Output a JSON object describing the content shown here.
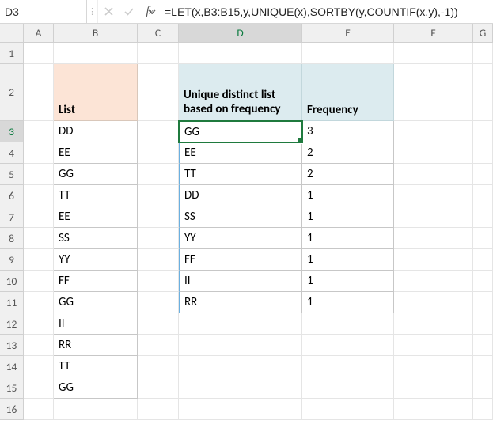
{
  "namebox": "D3",
  "formula": "=LET(x,B3:B15,y,UNIQUE(x),SORTBY(y,COUNTIF(x,y),-1))",
  "columns": [
    "A",
    "B",
    "C",
    "D",
    "E",
    "F",
    "G"
  ],
  "rows": [
    "1",
    "2",
    "3",
    "4",
    "5",
    "6",
    "7",
    "8",
    "9",
    "10",
    "11",
    "12",
    "13",
    "14",
    "15",
    "16"
  ],
  "headers": {
    "list": "List",
    "unique": "Unique distinct list based on frequency",
    "freq": "Frequency"
  },
  "list": [
    "DD",
    "EE",
    "GG",
    "TT",
    "EE",
    "SS",
    "YY",
    "FF",
    "GG",
    "II",
    "RR",
    "TT",
    "GG"
  ],
  "unique": [
    "GG",
    "EE",
    "TT",
    "DD",
    "SS",
    "YY",
    "FF",
    "II",
    "RR"
  ],
  "freq": [
    "3",
    "2",
    "2",
    "1",
    "1",
    "1",
    "1",
    "1",
    "1"
  ]
}
